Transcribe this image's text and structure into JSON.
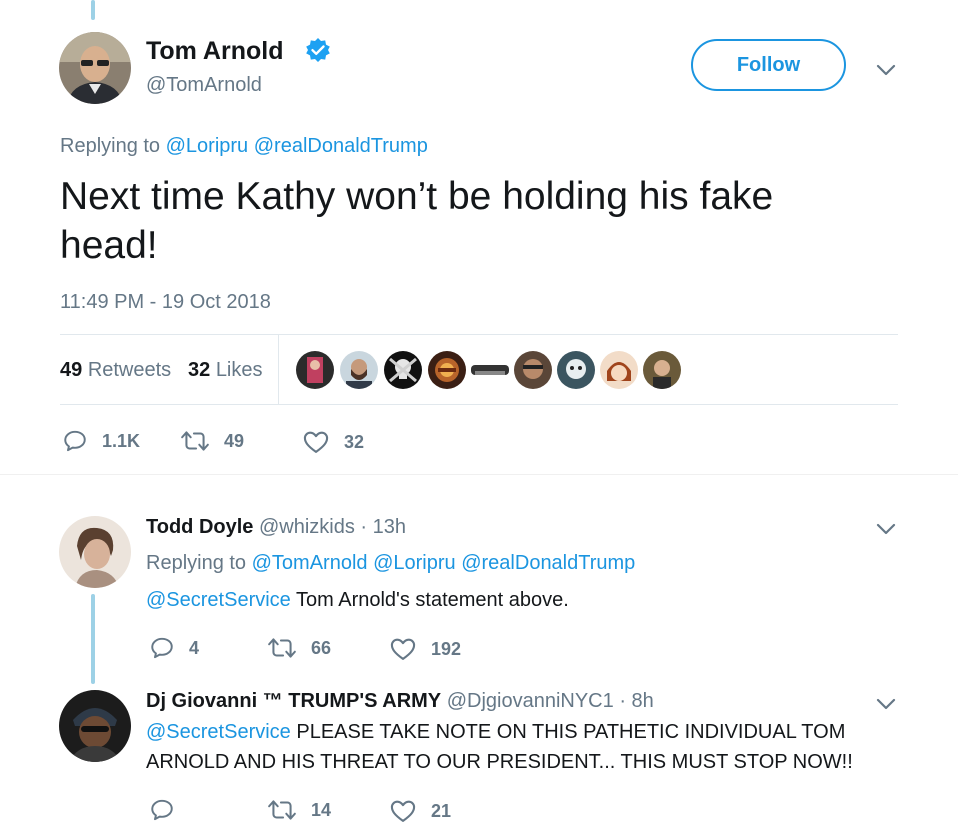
{
  "main_tweet": {
    "name": "Tom Arnold",
    "handle": "@TomArnold",
    "verified": true,
    "follow_label": "Follow",
    "replying_prefix": "Replying to",
    "replying_to": [
      "@Loripru",
      "@realDonaldTrump"
    ],
    "text_line1": "Next time Kathy won’t be holding his fake",
    "text_line2": "head!",
    "timestamp": "11:49 PM - 19 Oct 2018",
    "retweets_count": "49",
    "retweets_label": "Retweets",
    "likes_count": "32",
    "likes_label": "Likes",
    "actions": {
      "replies": "1.1K",
      "retweets": "49",
      "likes": "32"
    }
  },
  "replies": [
    {
      "name": "Todd Doyle",
      "handle": "@whizkids",
      "time": "· 13h",
      "replying_prefix": "Replying to",
      "replying_to": [
        "@TomArnold",
        "@Loripru",
        "@realDonaldTrump"
      ],
      "mention": "@SecretService",
      "text": " Tom Arnold's statement above.",
      "actions": {
        "replies": "4",
        "retweets": "66",
        "likes": "192"
      }
    },
    {
      "name": "Dj Giovanni ™ TRUMP'S ARMY",
      "handle": "@DjgiovanniNYC1",
      "time": "· 8h",
      "mention": "@SecretService",
      "text_line1": " PLEASE TAKE NOTE ON THIS PATHETIC INDIVIDUAL TOM",
      "text_line2": "ARNOLD AND HIS THREAT TO OUR PRESIDENT... THIS MUST STOP NOW!!",
      "actions": {
        "replies": "",
        "retweets": "14",
        "likes": "21"
      }
    }
  ],
  "colors": {
    "link": "#1b95e0",
    "muted": "#657786",
    "thread": "#9dd1e6",
    "verified": "#1da1f2"
  },
  "icons": [
    "verified-badge-icon",
    "chevron-down-icon",
    "reply-icon",
    "retweet-icon",
    "like-icon"
  ]
}
